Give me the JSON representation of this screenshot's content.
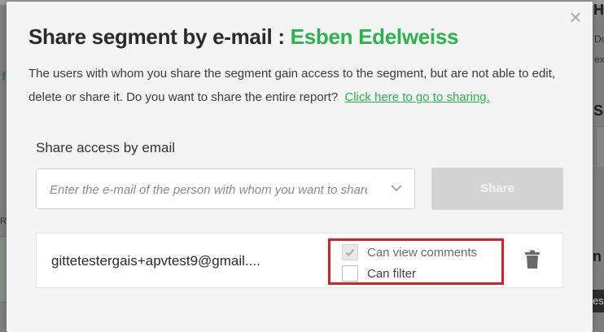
{
  "modal": {
    "title_prefix": "Share segment by e-mail : ",
    "segment_name": "Esben Edelweiss",
    "description": "The users with whom you share the segment gain access to the segment, but are not able to edit, delete or share it.  Do you want to share the entire report?",
    "sharing_link": "Click here to go to sharing.",
    "close_icon": "×"
  },
  "share_form": {
    "label": "Share access by email",
    "placeholder": "Enter the e-mail of the person with whom you want to share",
    "share_button": "Share"
  },
  "shared_users": [
    {
      "email": "gittetestergais+apvtest9@gmail....",
      "permissions": [
        {
          "label": "Can view comments",
          "checked": true
        },
        {
          "label": "Can filter",
          "checked": false
        }
      ]
    }
  ],
  "background": {
    "fragments": [
      "Hi",
      "Do",
      "ext",
      "Se",
      "n E",
      "es",
      "f",
      "RI"
    ]
  },
  "colors": {
    "accent_green": "#2bb34d",
    "highlight_red": "#d8202a",
    "disabled_button": "#d3d3d3"
  }
}
